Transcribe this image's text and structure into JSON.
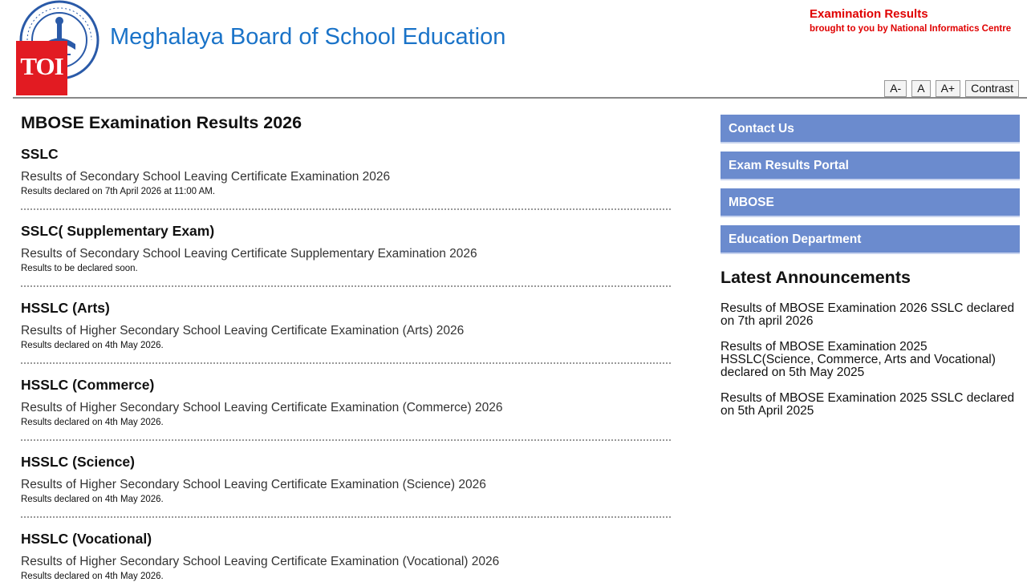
{
  "header": {
    "site_title": "Meghalaya Board of School Education",
    "toi_badge": "TOI",
    "exam_results": "Examination Results",
    "nic_credit": "brought to you by National Informatics Centre",
    "font_controls": [
      "A-",
      "A",
      "A+",
      "Contrast"
    ]
  },
  "main": {
    "heading": "MBOSE Examination Results 2026",
    "results": [
      {
        "title": "SSLC",
        "link": "Results of Secondary School Leaving Certificate Examination 2026",
        "status": "Results declared on 7th April 2026 at 11:00 AM."
      },
      {
        "title": "SSLC( Supplementary Exam)",
        "link": "Results of Secondary School Leaving Certificate Supplementary Examination 2026",
        "status": "Results to be declared soon."
      },
      {
        "title": "HSSLC (Arts)",
        "link": "Results of Higher Secondary School Leaving Certificate Examination (Arts) 2026",
        "status": "Results declared on 4th May 2026."
      },
      {
        "title": "HSSLC (Commerce)",
        "link": "Results of Higher Secondary School Leaving Certificate Examination (Commerce) 2026",
        "status": "Results declared on 4th May 2026."
      },
      {
        "title": "HSSLC (Science)",
        "link": "Results of Higher Secondary School Leaving Certificate Examination (Science) 2026",
        "status": "Results declared on 4th May 2026."
      },
      {
        "title": "HSSLC (Vocational)",
        "link": "Results of Higher Secondary School Leaving Certificate Examination (Vocational) 2026",
        "status": "Results declared on 4th May 2026."
      }
    ]
  },
  "sidebar": {
    "nav": [
      "Contact Us",
      "Exam Results Portal",
      "MBOSE",
      "Education Department"
    ],
    "announcements_heading": "Latest Announcements",
    "announcements": [
      "Results of MBOSE Examination 2026 SSLC declared on 7th april 2026",
      "Results of MBOSE Examination 2025 HSSLC(Science, Commerce, Arts and Vocational) declared on 5th May 2025",
      "Results of MBOSE Examination 2025 SSLC declared on 5th April 2025"
    ]
  },
  "colors": {
    "title_blue": "#1a73c8",
    "alert_red": "#e00000",
    "nav_blue": "#6b8bce",
    "toi_red": "#e21b22"
  }
}
